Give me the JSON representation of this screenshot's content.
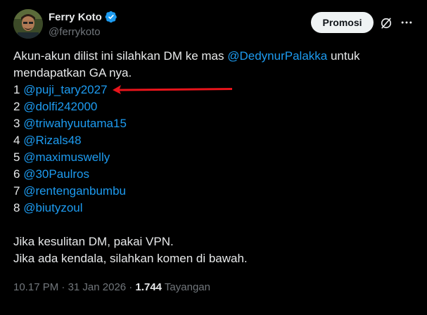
{
  "author": {
    "display_name": "Ferry Koto",
    "handle": "@ferrykoto",
    "verified_color": "#1d9bf0"
  },
  "header": {
    "promo_label": "Promosi",
    "grok_icon": "grok-icon",
    "more_icon": "more-icon"
  },
  "post": {
    "intro_line1_pre": "Akun-akun dilist ini silahkan DM ke mas ",
    "intro_mention": "@DedynurPalakka",
    "intro_line1_post": " untuk",
    "intro_line2": "mendapatkan GA nya.",
    "list": [
      {
        "num": "1 ",
        "handle": "@puji_tary2027"
      },
      {
        "num": "2 ",
        "handle": "@dolfi242000"
      },
      {
        "num": "3 ",
        "handle": "@triwahyuutama15"
      },
      {
        "num": "4 ",
        "handle": "@Rizals48"
      },
      {
        "num": "5 ",
        "handle": "@maximuswelly"
      },
      {
        "num": "6 ",
        "handle": "@30Paulros"
      },
      {
        "num": "7 ",
        "handle": "@rentenganbumbu"
      },
      {
        "num": "8 ",
        "handle": "@biutyzoul"
      }
    ],
    "outro_line1": "Jika kesulitan DM, pakai VPN.",
    "outro_line2": "Jika ada kendala, silahkan komen di bawah."
  },
  "meta": {
    "time": "10.17 PM",
    "sep1": " · ",
    "date": "31 Jan 2026",
    "sep2": " · ",
    "views": "1.744",
    "views_label": " Tayangan"
  },
  "annotation": {
    "arrow_color": "#e8141b"
  },
  "colors": {
    "background": "#000000",
    "text": "#e7e9ea",
    "muted": "#71767b",
    "link": "#1d9bf0"
  }
}
